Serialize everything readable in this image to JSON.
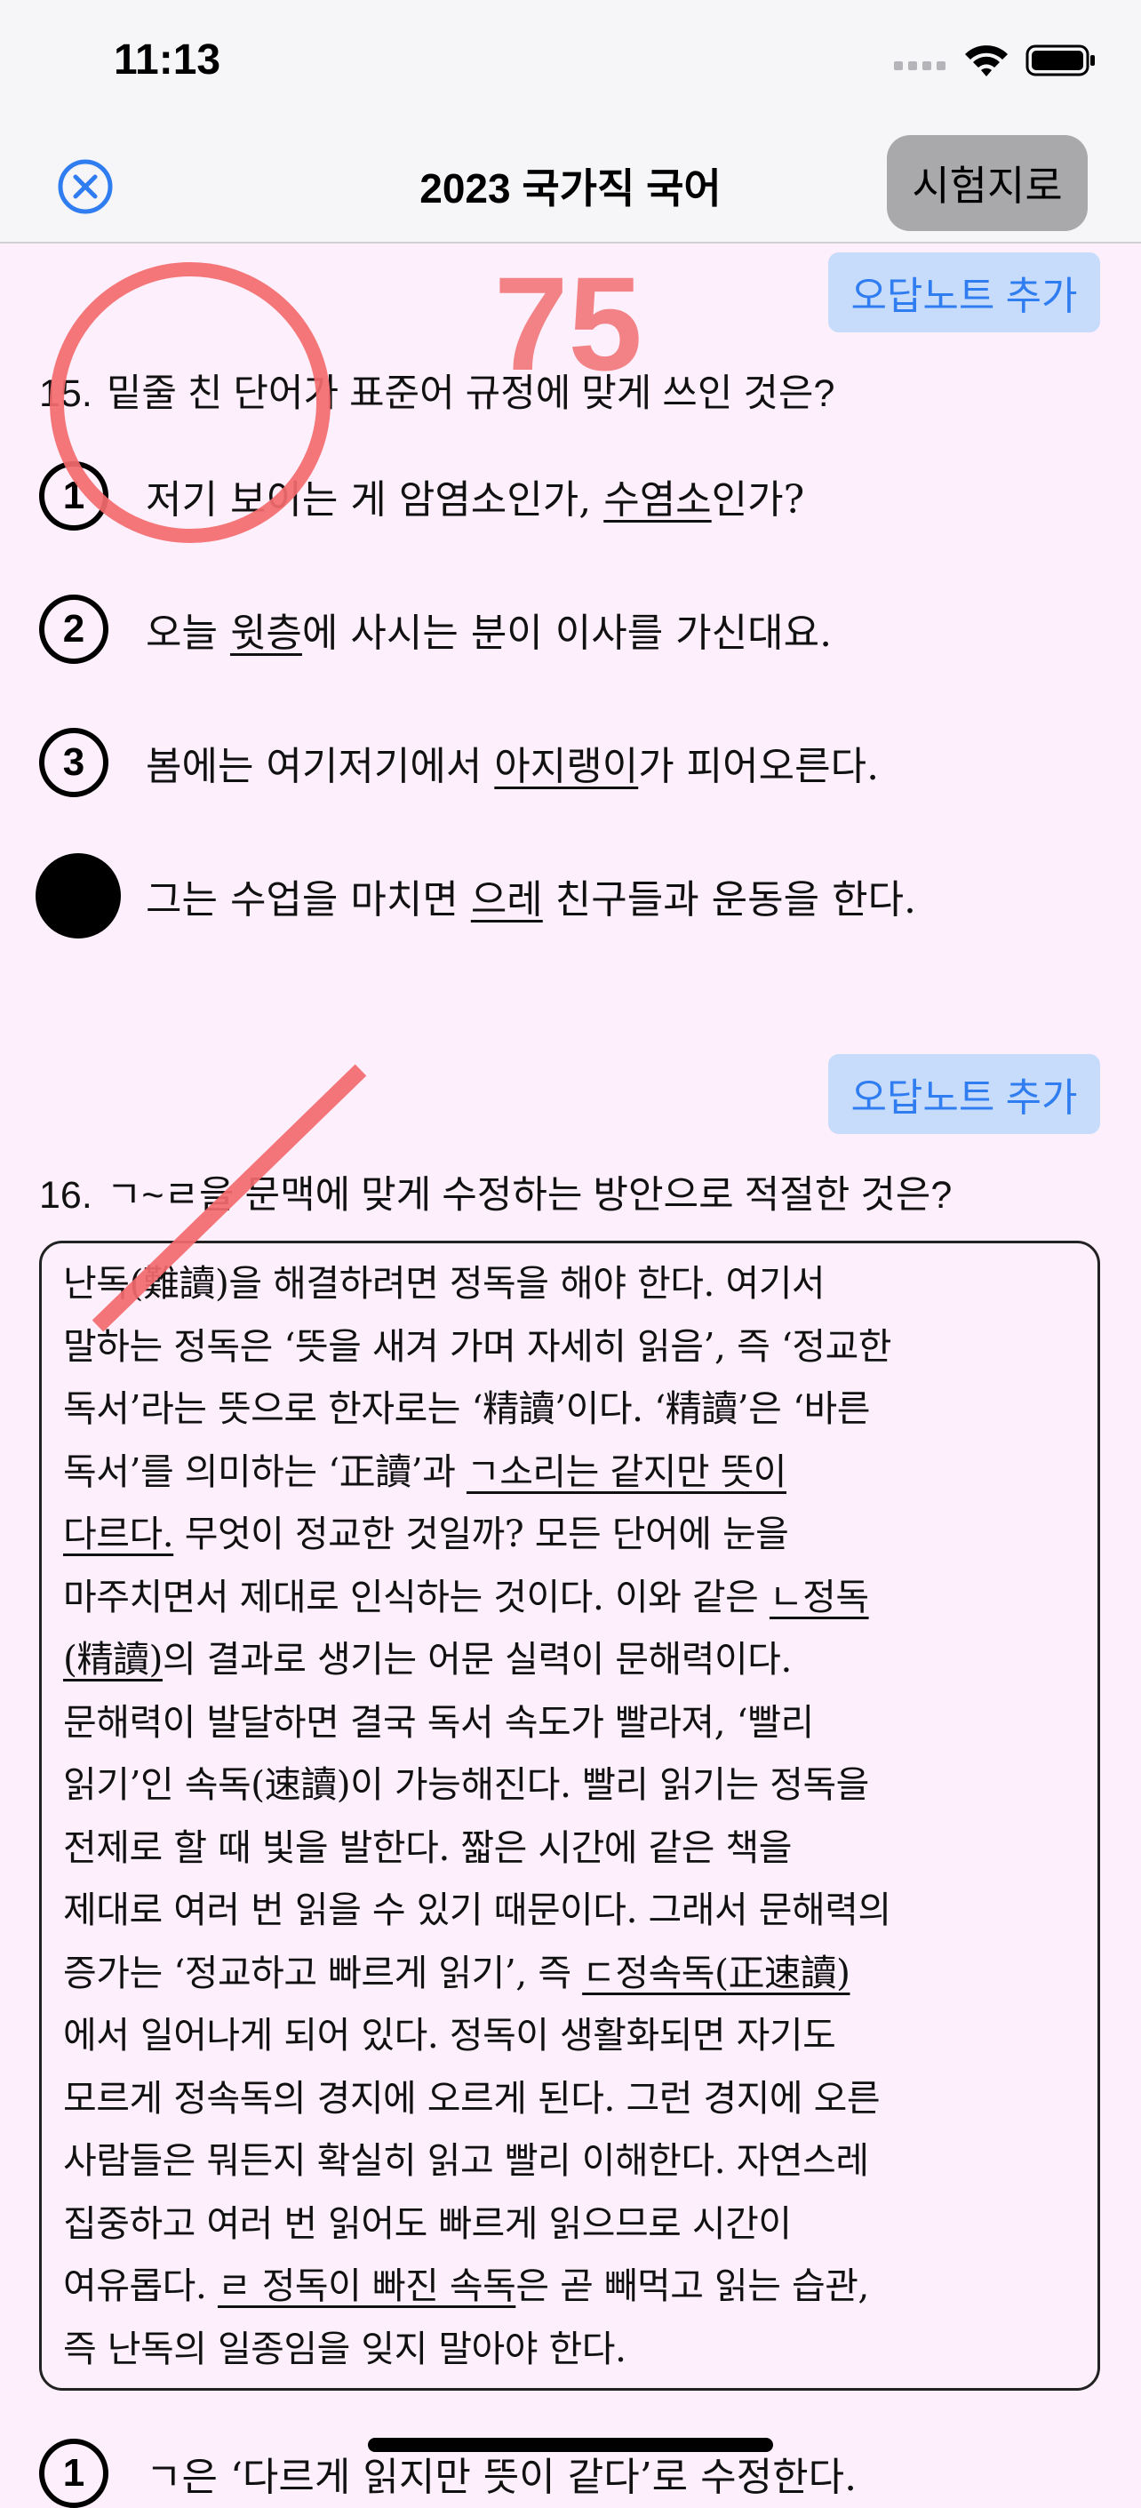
{
  "status": {
    "time": "11:13"
  },
  "nav": {
    "title": "2023 국가직 국어",
    "exam_button": "시험지로"
  },
  "score": "75",
  "note_button": "오답노트 추가",
  "q15": {
    "number": "15.",
    "text": "밑줄 친 단어가 표준어 규정에 맞게 쓰인 것은?",
    "choices": [
      {
        "marker": "1",
        "pre": "저기 보이는 게 암염소인가, ",
        "u": "수염소",
        "post": "인가?"
      },
      {
        "marker": "2",
        "pre": "오늘 ",
        "u": "윗층",
        "post": "에 사시는 분이 이사를 가신대요."
      },
      {
        "marker": "3",
        "pre": "봄에는 여기저기에서 ",
        "u": "아지랭이",
        "post": "가 피어오른다."
      },
      {
        "marker": "",
        "pre": "그는 수업을 마치면 ",
        "u": "으레",
        "post": " 친구들과 운동을 한다."
      }
    ]
  },
  "q16": {
    "number": "16.",
    "text": "ㄱ~ㄹ을 문맥에 맞게 수정하는 방안으로 적절한 것은?",
    "passage": [
      "난독(難讀)을 해결하려면 정독을 해야 한다. 여기서",
      "말하는 정독은 ‘뜻을 새겨 가며 자세히 읽음’, 즉 ‘정교한",
      "독서’라는 뜻으로 한자로는 ‘精讀’이다. ‘精讀’은 ‘바른",
      "독서’를 의미하는 ‘正讀’과 ",
      "다르다.",
      "마주치면서 제대로 인식하는 것이다. 이와 같은 ",
      "(精讀)",
      "문해력이 발달하면 결국 독서 속도가 빨라져, ‘빨리",
      "읽기’인 속독(速讀)이 가능해진다. 빨리 읽기는 정독을",
      "전제로 할 때 빛을 발한다. 짧은 시간에 같은 책을",
      "제대로 여러 번 읽을 수 있기 때문이다. 그래서 문해력의",
      "증가는 ‘정교하고 빠르게 읽기’, 즉 ",
      "에서 일어나게 되어 있다. 정독이 생활화되면 자기도",
      "모르게 정속독의 경지에 오르게 된다. 그런 경지에 오른",
      "사람들은 뭐든지 확실히 읽고 빨리 이해한다. 자연스레",
      "집중하고 여러 번 읽어도 빠르게 읽으므로 시간이",
      "여유롭다. ",
      "즉 난독의 일종임을 잊지 말아야 한다."
    ],
    "passage_u": {
      "l4": "ㄱ소리는 같지만 뜻이",
      "l5": " 무엇이 정교한 것일까? 모든 단어에 눈을",
      "l6": "ㄴ정독",
      "l7": "의 결과로 생기는 어문 실력이 문해력이다.",
      "l12": "ㄷ정속독(正速讀)",
      "l17u": "ㄹ 정독이 빠진 속독",
      "l17": "은 곧 빼먹고 읽는 습관,"
    },
    "partial_choice": {
      "marker": "1",
      "text": "ㄱ은 ‘다르게 읽지만 뜻이 같다’로 수정한다."
    }
  }
}
